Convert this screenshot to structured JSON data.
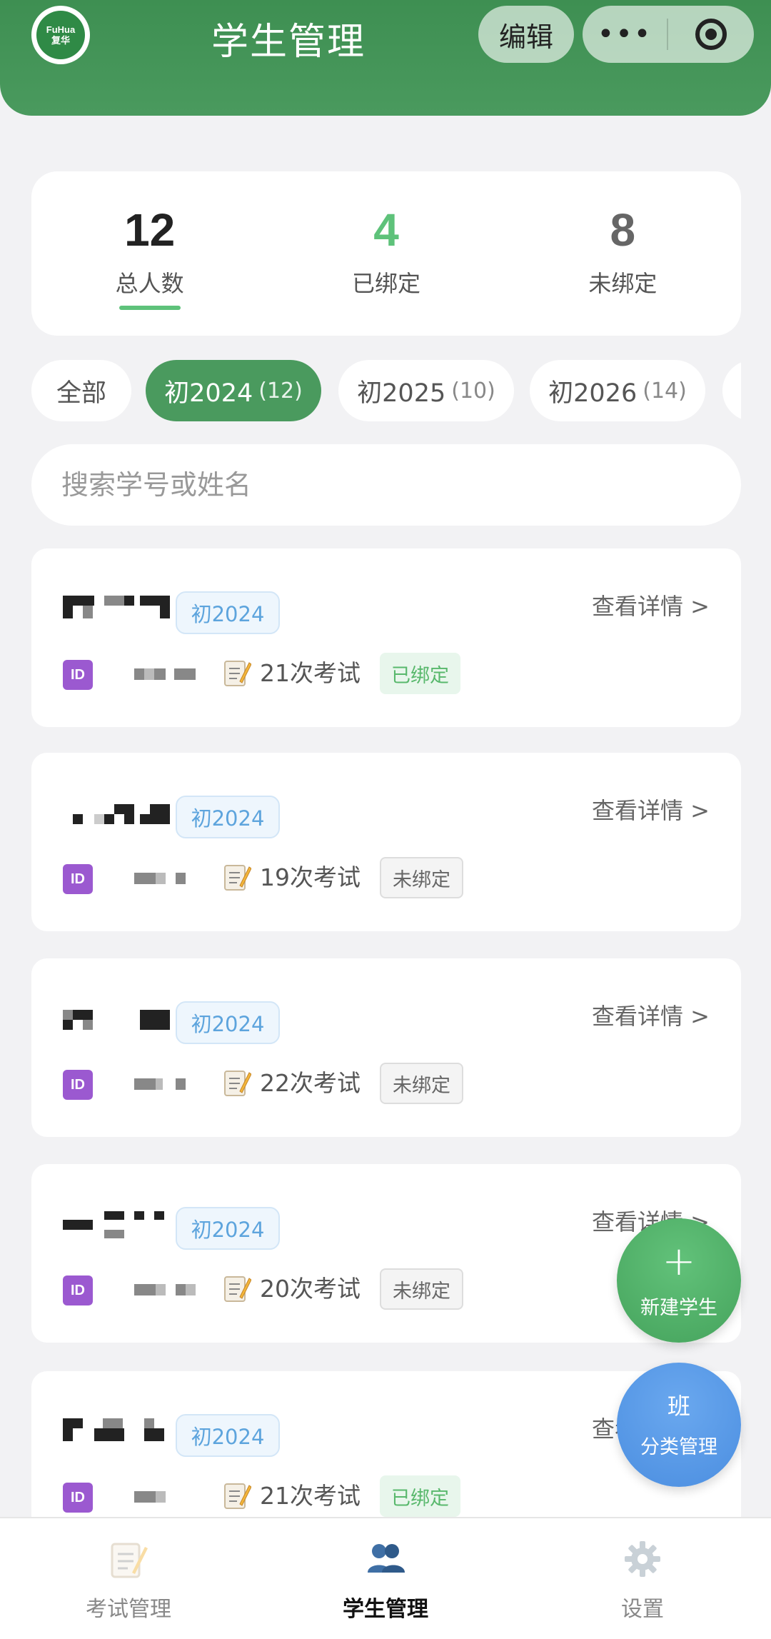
{
  "header": {
    "logo_text": "FuHua",
    "logo_cn": "复华",
    "title": "学生管理",
    "edit_label": "编辑",
    "more_label": "•••"
  },
  "stats": [
    {
      "value": "12",
      "label": "总人数",
      "color": "#222222"
    },
    {
      "value": "4",
      "label": "已绑定",
      "color": "#5ec27a"
    },
    {
      "value": "8",
      "label": "未绑定",
      "color": "#666666"
    }
  ],
  "filters": [
    {
      "label": "全部",
      "count": ""
    },
    {
      "label": "初2024",
      "count": "(12)"
    },
    {
      "label": "初2025",
      "count": "(10)"
    },
    {
      "label": "初2026",
      "count": "(14)"
    }
  ],
  "search": {
    "placeholder": "搜索学号或姓名"
  },
  "students": [
    {
      "grade": "初2024",
      "exams": "21次考试",
      "status": "已绑定",
      "detail": "查看详情 >"
    },
    {
      "grade": "初2024",
      "exams": "19次考试",
      "status": "未绑定",
      "detail": "查看详情 >"
    },
    {
      "grade": "初2024",
      "exams": "22次考试",
      "status": "未绑定",
      "detail": "查看详情 >"
    },
    {
      "grade": "初2024",
      "exams": "20次考试",
      "status": "未绑定",
      "detail": "查看详情 >"
    },
    {
      "grade": "初2024",
      "exams": "21次考试",
      "status": "已绑定",
      "detail": "查看详情 >"
    }
  ],
  "id_icon_text": "ID",
  "fab": {
    "new_label": "新建学生",
    "class_icon": "班",
    "class_label": "分类管理"
  },
  "nav": [
    {
      "label": "考试管理",
      "icon": "memo-icon"
    },
    {
      "label": "学生管理",
      "icon": "people-icon"
    },
    {
      "label": "设置",
      "icon": "gear-icon"
    }
  ]
}
